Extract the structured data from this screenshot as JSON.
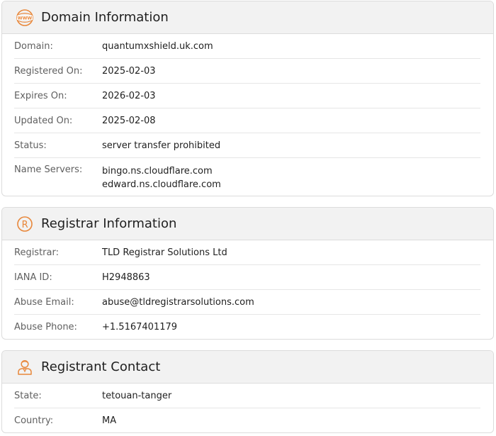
{
  "domain_info": {
    "title": "Domain Information",
    "icon": "www-globe-icon",
    "rows": [
      {
        "label": "Domain:",
        "value": "quantumxshield.uk.com"
      },
      {
        "label": "Registered On:",
        "value": "2025-02-03"
      },
      {
        "label": "Expires On:",
        "value": "2026-02-03"
      },
      {
        "label": "Updated On:",
        "value": "2025-02-08"
      },
      {
        "label": "Status:",
        "value": "server transfer prohibited"
      },
      {
        "label": "Name Servers:",
        "values": [
          "bingo.ns.cloudflare.com",
          "edward.ns.cloudflare.com"
        ]
      }
    ]
  },
  "registrar_info": {
    "title": "Registrar Information",
    "icon": "registered-icon",
    "rows": [
      {
        "label": "Registrar:",
        "value": "TLD Registrar Solutions Ltd"
      },
      {
        "label": "IANA ID:",
        "value": "H2948863"
      },
      {
        "label": "Abuse Email:",
        "value": "abuse@tldregistrarsolutions.com"
      },
      {
        "label": "Abuse Phone:",
        "value": "+1.5167401179"
      }
    ]
  },
  "registrant_contact": {
    "title": "Registrant Contact",
    "icon": "person-icon",
    "rows": [
      {
        "label": "State:",
        "value": "tetouan-tanger"
      },
      {
        "label": "Country:",
        "value": "MA"
      }
    ]
  },
  "colors": {
    "accent": "#e8873a",
    "header_bg": "#f2f2f2",
    "border": "#dcdcdc"
  }
}
